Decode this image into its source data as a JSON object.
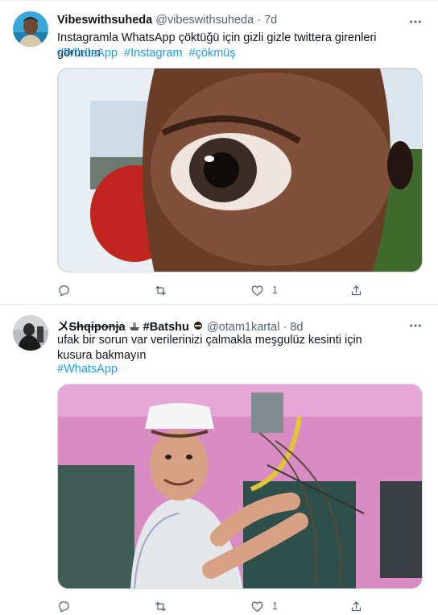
{
  "tweets": [
    {
      "name": "Vibeswithsuheda",
      "handle": "@vibeswithsuheda",
      "separator": "·",
      "time": "7d",
      "text": "Instagramla WhatsApp çöktüğü için gizli gizle twittera girenleri görürüm",
      "hashtags": [
        "#WhatsApp",
        "#Instagram",
        "#çökmüş"
      ],
      "stats": {
        "replies": "",
        "retweets": "",
        "likes": "1"
      }
    },
    {
      "name_prefix": "〤",
      "name_struck": "Shqiponja",
      "name_mid": "#Batshu",
      "handle": "@otam1kartal",
      "separator": "·",
      "time": "8d",
      "text": "ufak bir sorun var verilerinizi çalmakla meşgulüz kesinti için kusura bakmayın",
      "hashtags": [
        "#WhatsApp"
      ],
      "stats": {
        "replies": "",
        "retweets": "",
        "likes": "1"
      }
    }
  ],
  "icons": {
    "more": "more-horizontal-icon",
    "reply": "reply-icon",
    "retweet": "retweet-icon",
    "like": "heart-icon",
    "share": "share-icon"
  },
  "colors": {
    "accent": "#1d9bf0",
    "muted": "#536471",
    "text": "#0f1419"
  }
}
